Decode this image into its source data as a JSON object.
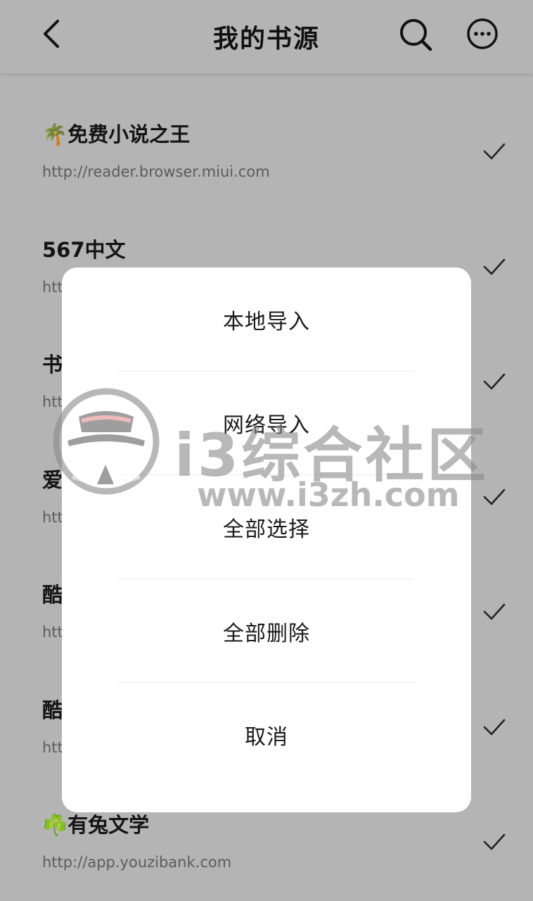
{
  "header": {
    "title": "我的书源"
  },
  "sources": [
    {
      "name": "🌴免费小说之王",
      "url": "http://reader.browser.miui.com"
    },
    {
      "name": "567中文",
      "url": "htt"
    },
    {
      "name": "书",
      "url": "htt"
    },
    {
      "name": "爱",
      "url": "htt"
    },
    {
      "name": "酷",
      "url": "htt"
    },
    {
      "name": "酷",
      "url": "htt"
    },
    {
      "name": "☘️有兔文学",
      "url": "http://app.youzibank.com"
    }
  ],
  "dialog": {
    "options": [
      "本地导入",
      "网络导入",
      "全部选择",
      "全部删除",
      "取消"
    ]
  },
  "watermark": {
    "text": "i3综合社区",
    "url": "www.i3zh.com"
  },
  "icons": {
    "back": "chevron-left-icon",
    "search": "search-icon",
    "more": "more-horizontal-icon",
    "check": "check-icon",
    "logo": "detective-hat-logo"
  }
}
